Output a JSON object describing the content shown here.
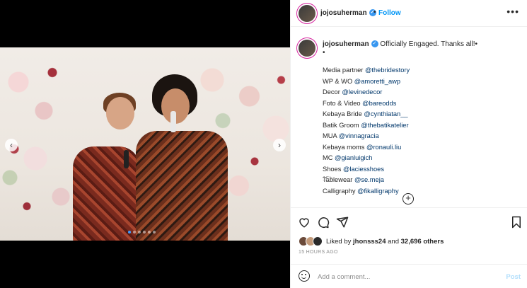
{
  "header": {
    "username": "jojosuherman",
    "separator": "•",
    "follow_label": "Follow",
    "more_icon": "more-horizontal-icon"
  },
  "caption": {
    "username": "jojosuherman",
    "text": "Officially Engaged. Thanks all!•",
    "second_line": "•",
    "credits": [
      {
        "label": "Media partner ",
        "mention": "@thebridestory"
      },
      {
        "label": "WP & WO ",
        "mention": "@amoretti_awp"
      },
      {
        "label": "Decor ",
        "mention": "@levinedecor"
      },
      {
        "label": "Foto & Video ",
        "mention": "@bareodds"
      },
      {
        "label": "Kebaya Bride ",
        "mention": "@cynthiatan__"
      },
      {
        "label": "Batik Groom ",
        "mention": "@thebatikatelier"
      },
      {
        "label": "MUA ",
        "mention": "@vinnagracia"
      },
      {
        "label": "Kebaya moms ",
        "mention": "@ronauli.liu"
      },
      {
        "label": "MC ",
        "mention": "@gianluigich"
      },
      {
        "label": "Shoes ",
        "mention": "@laciesshoes"
      },
      {
        "label": "Tablewear ",
        "mention": "@se.meja"
      },
      {
        "label": "Calligraphy ",
        "mention": "@fikalligraphy"
      }
    ],
    "time": "15h",
    "load_more_icon": "plus-circle-icon"
  },
  "media": {
    "nav_prev": "‹",
    "nav_next": "›",
    "slides_count": 6,
    "active_slide": 0,
    "colors": {
      "active_dot": "#3f9cff"
    }
  },
  "actions": {
    "icons": [
      "heart-icon",
      "comment-icon",
      "share-icon",
      "bookmark-icon"
    ]
  },
  "likes": {
    "prefix": "Liked by ",
    "user": "jhonsss24",
    "middle": " and ",
    "count": "32,696 others"
  },
  "timestamp": "15 HOURS AGO",
  "comment": {
    "placeholder": "Add a comment...",
    "post_label": "Post"
  },
  "colors": {
    "accent": "#0095f6",
    "mention": "#00376b",
    "muted": "#8e8e8e"
  }
}
